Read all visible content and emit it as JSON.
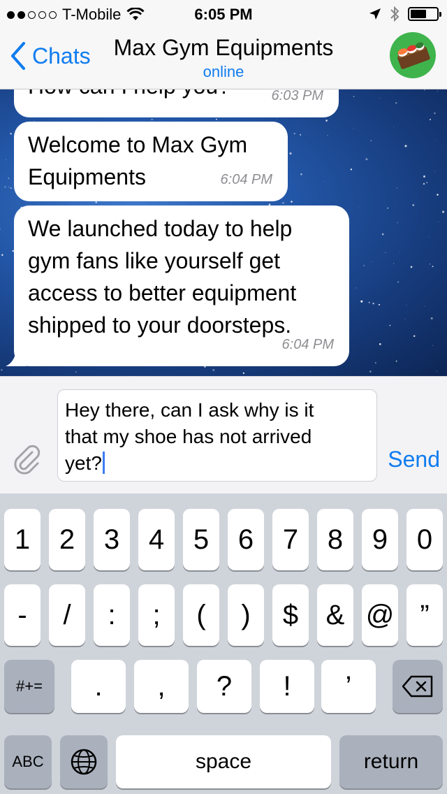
{
  "status_bar": {
    "carrier": "T-Mobile",
    "time": "6:05 PM"
  },
  "nav": {
    "back_label": "Chats",
    "title": "Max Gym Equipments",
    "subtitle": "online"
  },
  "messages": [
    {
      "text": "How can I help you?",
      "time": "6:03 PM"
    },
    {
      "text_lines": [
        "Welcome to Max Gym",
        "Equipments"
      ],
      "time": "6:04 PM"
    },
    {
      "text_lines": [
        "We launched today to help",
        "gym fans like yourself get",
        "access to better equipment",
        "shipped to your doorsteps."
      ],
      "time": "6:04 PM"
    }
  ],
  "composer": {
    "text_lines": [
      "Hey there, can I ask why is it",
      "that my shoe has not arrived",
      "yet?"
    ],
    "send_label": "Send"
  },
  "keyboard": {
    "row1": [
      "1",
      "2",
      "3",
      "4",
      "5",
      "6",
      "7",
      "8",
      "9",
      "0"
    ],
    "row2": [
      "-",
      "/",
      ":",
      ";",
      "(",
      ")",
      "$",
      "&",
      "@",
      "”"
    ],
    "row3": {
      "shift": "#+=",
      "keys": [
        ".",
        ",",
        "?",
        "!",
        "’"
      ]
    },
    "row4": {
      "abc": "ABC",
      "space": "space",
      "return": "return"
    }
  }
}
